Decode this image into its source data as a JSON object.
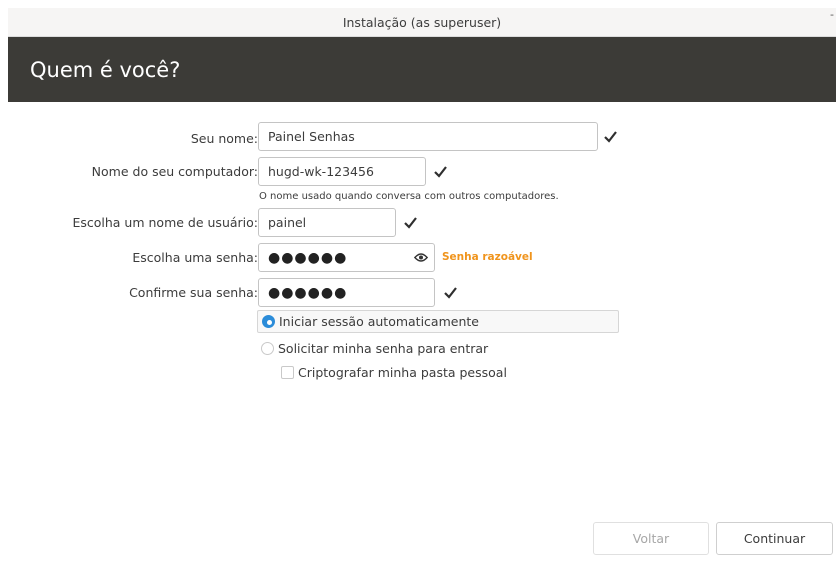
{
  "window": {
    "title": "Instalação (as superuser)",
    "minimize_glyph": "-"
  },
  "header": {
    "heading": "Quem é você?"
  },
  "form": {
    "name": {
      "label": "Seu nome:",
      "value": "Painel Senhas",
      "valid_icon": "checkmark-icon"
    },
    "computer": {
      "label": "Nome do seu computador:",
      "value": "hugd-wk-123456",
      "hint": "O nome usado quando conversa com outros computadores.",
      "valid_icon": "checkmark-icon"
    },
    "username": {
      "label": "Escolha um nome de usuário:",
      "value": "painel",
      "valid_icon": "checkmark-icon"
    },
    "password": {
      "label": "Escolha uma senha:",
      "value": "●●●●●●",
      "strength": "Senha razoável",
      "show_icon": "eye-icon"
    },
    "confirm": {
      "label": "Confirme sua senha:",
      "value": "●●●●●●",
      "valid_icon": "checkmark-icon"
    }
  },
  "login_options": {
    "auto_login": {
      "label": "Iniciar sessão automaticamente",
      "selected": true
    },
    "require_password": {
      "label": "Solicitar minha senha para entrar",
      "selected": false
    },
    "encrypt_home": {
      "label": "Criptografar minha pasta pessoal",
      "checked": false
    }
  },
  "buttons": {
    "back": "Voltar",
    "continue": "Continuar"
  },
  "colors": {
    "header_bg": "#3c3b37",
    "accent": "#2b8cd9",
    "strength_color": "#f0941c"
  }
}
